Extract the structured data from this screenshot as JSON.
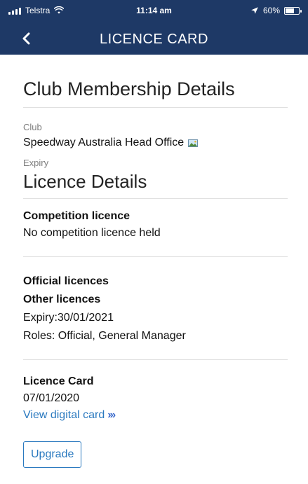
{
  "status_bar": {
    "carrier": "Telstra",
    "time": "11:14 am",
    "battery": "60%"
  },
  "nav": {
    "title": "LICENCE CARD"
  },
  "membership": {
    "heading": "Club Membership Details",
    "club_label": "Club",
    "club_value": "Speedway Australia Head Office",
    "expiry_label": "Expiry"
  },
  "licence": {
    "heading": "Licence Details",
    "competition_title": "Competition licence",
    "competition_text": "No competition licence held",
    "official_title": "Official licences",
    "other_title": "Other licences",
    "other_expiry": "Expiry:30/01/2021",
    "other_roles": "Roles: Official, General Manager",
    "card_title": "Licence Card",
    "card_date": "07/01/2020",
    "view_card_link": "View digital card",
    "upgrade_button": "Upgrade"
  },
  "colors": {
    "header_bg": "#1e3966",
    "link": "#2a79bf"
  },
  "icons": {
    "signal": "signal-bars-icon",
    "wifi": "wifi-icon",
    "location": "location-arrow-icon",
    "battery": "battery-icon",
    "back": "chevron-left-icon",
    "image": "image-icon",
    "chevrons": "double-chevron-right-icon"
  }
}
